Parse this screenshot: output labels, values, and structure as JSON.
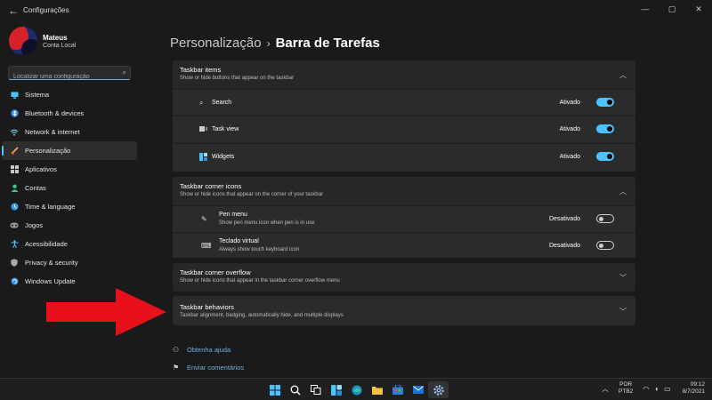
{
  "window": {
    "title": "Configurações",
    "controls": [
      "—",
      "▢",
      "✕"
    ]
  },
  "profile": {
    "name": "Mateus",
    "account": "Conta Local"
  },
  "search": {
    "placeholder": "Localizar uma configuração"
  },
  "nav": {
    "items": [
      {
        "label": "Sistema",
        "icon": "monitor-icon"
      },
      {
        "label": "Bluetooth & devices",
        "icon": "bluetooth-icon"
      },
      {
        "label": "Network & internet",
        "icon": "wifi-icon"
      },
      {
        "label": "Personalização",
        "icon": "brush-icon",
        "active": true
      },
      {
        "label": "Aplicativos",
        "icon": "apps-icon"
      },
      {
        "label": "Contas",
        "icon": "person-icon"
      },
      {
        "label": "Time & language",
        "icon": "globe-clock-icon"
      },
      {
        "label": "Jogos",
        "icon": "gamepad-icon"
      },
      {
        "label": "Acessibilidade",
        "icon": "accessibility-icon"
      },
      {
        "label": "Privacy & security",
        "icon": "shield-icon"
      },
      {
        "label": "Windows Update",
        "icon": "update-icon"
      }
    ]
  },
  "breadcrumb": {
    "parent": "Personalização",
    "separator": "›",
    "current": "Barra de Tarefas"
  },
  "sections": {
    "items": {
      "title": "Taskbar items",
      "subtitle": "Show or hide buttons that appear on the taskbar",
      "rows": [
        {
          "label": "Search",
          "state": "Ativado",
          "on": true
        },
        {
          "label": "Task view",
          "state": "Ativado",
          "on": true
        },
        {
          "label": "Widgets",
          "state": "Ativado",
          "on": true
        }
      ]
    },
    "corner_icons": {
      "title": "Taskbar corner icons",
      "subtitle": "Show or hide icons that appear on the corner of your taskbar",
      "rows": [
        {
          "label": "Pen menu",
          "sub": "Show pen menu icon when pen is in use",
          "state": "Desativado",
          "on": false
        },
        {
          "label": "Teclado virtual",
          "sub": "Always show touch keyboard icon",
          "state": "Desativado",
          "on": false
        }
      ]
    },
    "overflow": {
      "title": "Taskbar corner overflow",
      "subtitle": "Show or hide icons that appear in the taskbar corner overflow menu"
    },
    "behaviors": {
      "title": "Taskbar behaviors",
      "subtitle": "Taskbar alignment, badging, automatically hide, and multiple displays"
    }
  },
  "links": {
    "help": "Obtenha ajuda",
    "feedback": "Enviar comentários"
  },
  "taskbar": {
    "lang_top": "POR",
    "lang_bottom": "PTB2",
    "time": "09:12",
    "date": "8/7/2021"
  },
  "colors": {
    "accent": "#4cc2ff",
    "link": "#6fb1e0",
    "arrow": "#e8101a"
  }
}
